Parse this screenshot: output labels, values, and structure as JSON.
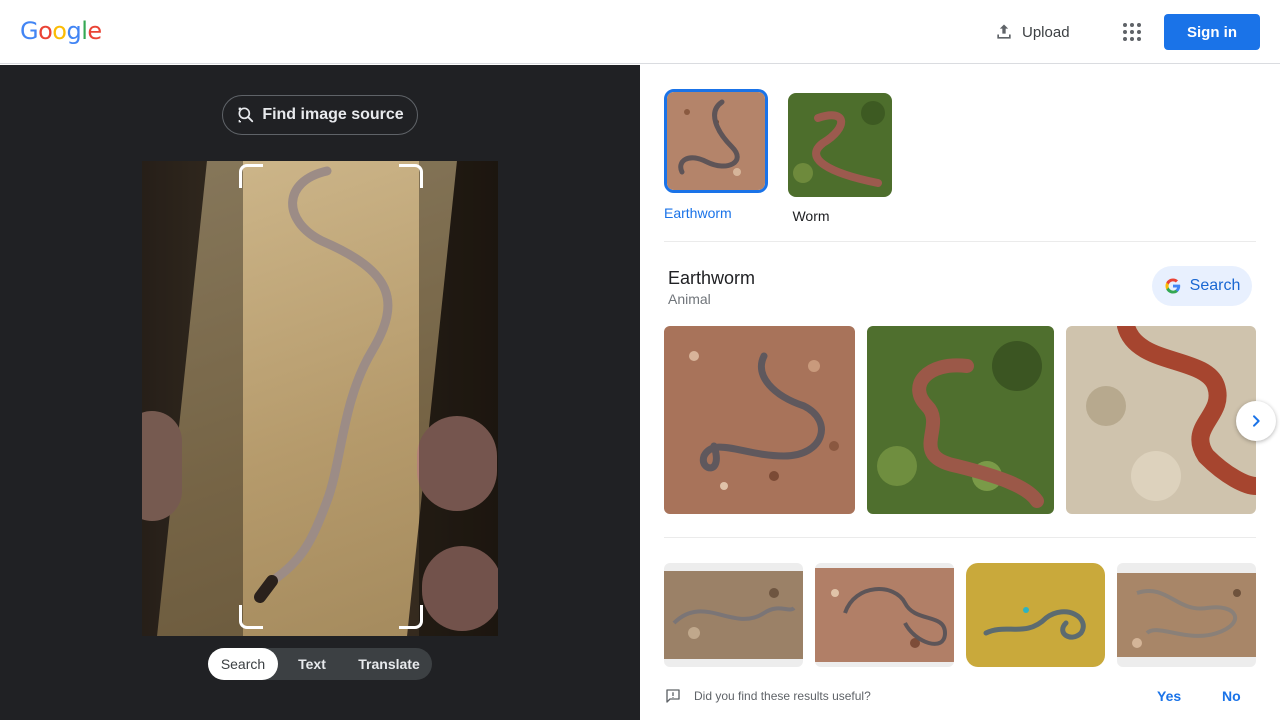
{
  "header": {
    "logo_letters": [
      {
        "ch": "G",
        "color": "#4285F4"
      },
      {
        "ch": "o",
        "color": "#EA4335"
      },
      {
        "ch": "o",
        "color": "#FBBC05"
      },
      {
        "ch": "g",
        "color": "#4285F4"
      },
      {
        "ch": "l",
        "color": "#34A853"
      },
      {
        "ch": "e",
        "color": "#EA4335"
      }
    ],
    "upload_label": "Upload",
    "upload_icon": "upload-icon",
    "apps_icon": "apps-grid-icon",
    "signin_label": "Sign in"
  },
  "left_panel": {
    "find_source_label": "Find image source",
    "find_source_icon": "lens-search-icon",
    "mode_tabs": [
      {
        "label": "Search",
        "active": true
      },
      {
        "label": "Text",
        "active": false
      },
      {
        "label": "Translate",
        "active": false
      }
    ]
  },
  "right_panel": {
    "chips": [
      {
        "label": "Earthworm",
        "active": true
      },
      {
        "label": "Worm",
        "active": false
      }
    ],
    "entity": {
      "title": "Earthworm",
      "subtitle": "Animal",
      "search_label": "Search"
    },
    "feedback": {
      "question": "Did you find these results useful?",
      "yes": "Yes",
      "no": "No"
    }
  },
  "colors": {
    "accent": "#1a73e8",
    "dark_bg": "#202124"
  }
}
